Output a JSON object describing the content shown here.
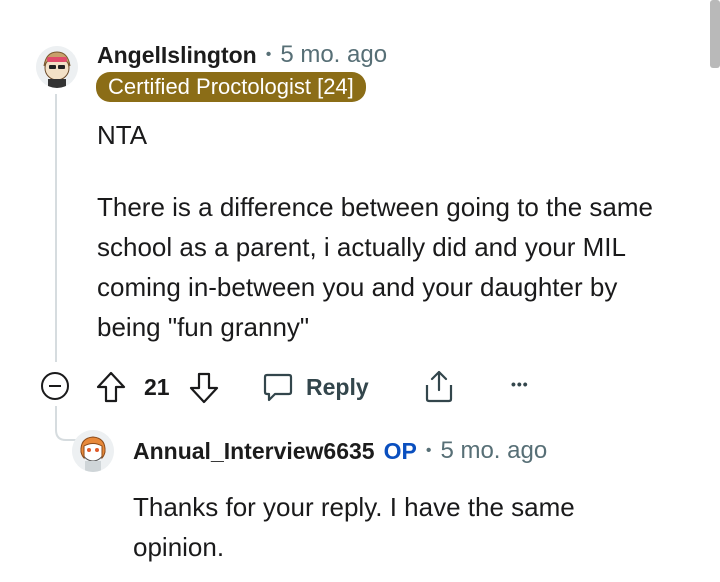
{
  "comment": {
    "username": "AngelIslington",
    "separator": "•",
    "age": "5 mo. ago",
    "flair": "Certified Proctologist [24]",
    "paragraphs": [
      "NTA",
      "There is a difference between going to the same school as a parent, i actually did and your MIL coming in-between you and your daughter by being \"fun granny\""
    ],
    "score": "21",
    "reply_label": "Reply",
    "more_label": "•••"
  },
  "reply": {
    "username": "Annual_Interview6635",
    "op_badge": "OP",
    "separator": "•",
    "age": "5 mo. ago",
    "text": "Thanks for your reply. I have the same opinion."
  },
  "colors": {
    "flair_bg": "#8b6d17",
    "op_blue": "#0a4fbf",
    "meta_gray": "#576f76",
    "action_gray": "#33464c"
  }
}
